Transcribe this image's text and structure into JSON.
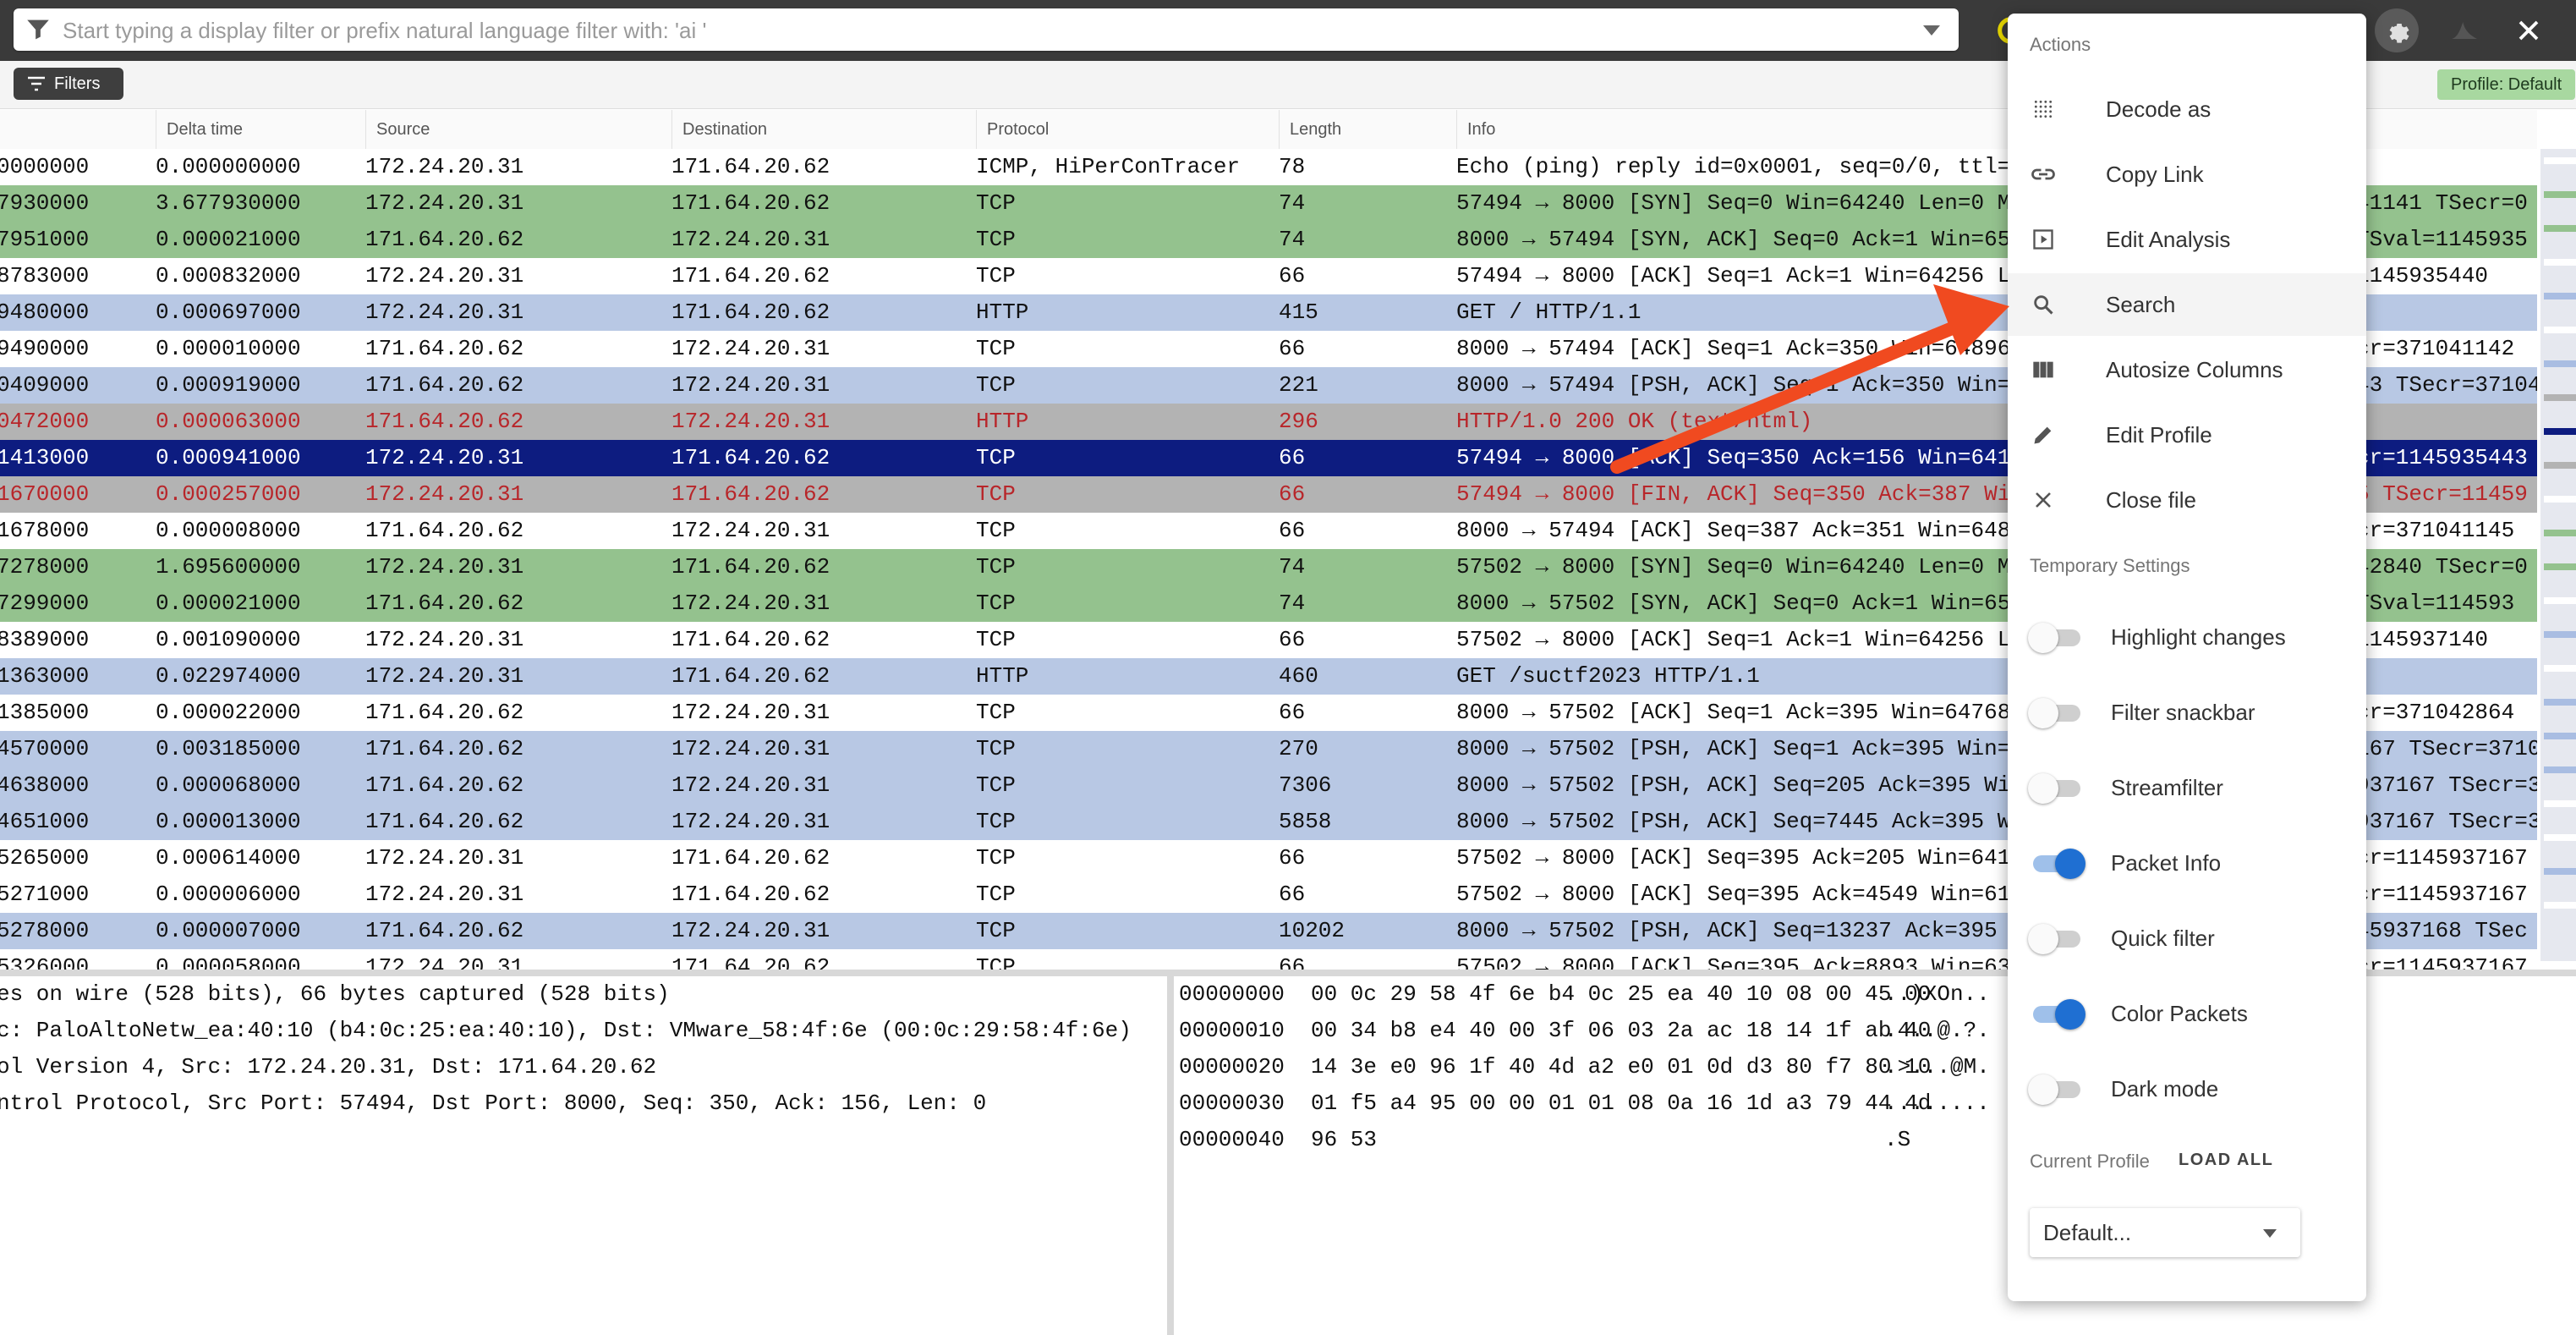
{
  "filter": {
    "placeholder": "Start typing a display filter or prefix natural language filter with: 'ai '"
  },
  "subbar": {
    "filters_label": "Filters",
    "profile_chip": "Profile: Default"
  },
  "columns": [
    "Delta time",
    "Source",
    "Destination",
    "Protocol",
    "Length",
    "Info"
  ],
  "rows": [
    {
      "style": "white",
      "no": "0000000",
      "delta": "0.000000000",
      "src": "172.24.20.31",
      "dst": "171.64.20.62",
      "proto": "ICMP, HiPerConTracer",
      "len": "78",
      "info": "Echo (ping) reply id=0x0001, seq=0/0, ttl=6"
    },
    {
      "style": "green",
      "no": "7930000",
      "delta": "3.677930000",
      "src": "172.24.20.31",
      "dst": "171.64.20.62",
      "proto": "TCP",
      "len": "74",
      "info": "57494 → 8000 [SYN] Seq=0 Win=64240 Len=0 MSS",
      "info2": "41141 TSecr=0"
    },
    {
      "style": "green",
      "no": "7951000",
      "delta": "0.000021000",
      "src": "171.64.20.62",
      "dst": "172.24.20.31",
      "proto": "TCP",
      "len": "74",
      "info": "8000 → 57494 [SYN, ACK] Seq=0 Ack=1 Win=651",
      "info2": "TSval=1145935"
    },
    {
      "style": "white",
      "no": "8783000",
      "delta": "0.000832000",
      "src": "172.24.20.31",
      "dst": "171.64.20.62",
      "proto": "TCP",
      "len": "66",
      "info": "57494 → 8000 [ACK] Seq=1 Ack=1 Win=64256 Le",
      "info2": "1145935440"
    },
    {
      "style": "blue",
      "no": "9480000",
      "delta": "0.000697000",
      "src": "172.24.20.31",
      "dst": "171.64.20.62",
      "proto": "HTTP",
      "len": "415",
      "info": "GET / HTTP/1.1",
      "info2": ""
    },
    {
      "style": "white",
      "no": "9490000",
      "delta": "0.000010000",
      "src": "171.64.20.62",
      "dst": "172.24.20.31",
      "proto": "TCP",
      "len": "66",
      "info": "8000 → 57494 [ACK] Seq=1 Ack=350 Win=64896",
      "info2": "cr=371041142"
    },
    {
      "style": "blue",
      "no": "0409000",
      "delta": "0.000919000",
      "src": "171.64.20.62",
      "dst": "172.24.20.31",
      "proto": "TCP",
      "len": "221",
      "info": "8000 → 57494 [PSH, ACK] Seq=1 Ack=350 Win=6",
      "info2": "43 TSecr=37104"
    },
    {
      "style": "red",
      "no": "0472000",
      "delta": "0.000063000",
      "src": "171.64.20.62",
      "dst": "172.24.20.31",
      "proto": "HTTP",
      "len": "296",
      "info": "HTTP/1.0 200 OK (text/html)",
      "info2": ""
    },
    {
      "style": "sel",
      "no": "1413000",
      "delta": "0.000941000",
      "src": "172.24.20.31",
      "dst": "171.64.20.62",
      "proto": "TCP",
      "len": "66",
      "info": "57494 → 8000 [ACK] Seq=350 Ack=156 Win=6412",
      "info2": "cr=1145935443"
    },
    {
      "style": "red",
      "no": "1670000",
      "delta": "0.000257000",
      "src": "172.24.20.31",
      "dst": "171.64.20.62",
      "proto": "TCP",
      "len": "66",
      "info": "57494 → 8000 [FIN, ACK] Seq=350 Ack=387 Win",
      "info2": "5 TSecr=11459"
    },
    {
      "style": "white",
      "no": "1678000",
      "delta": "0.000008000",
      "src": "171.64.20.62",
      "dst": "172.24.20.31",
      "proto": "TCP",
      "len": "66",
      "info": "8000 → 57494 [ACK] Seq=387 Ack=351 Win=6489",
      "info2": "cr=371041145"
    },
    {
      "style": "green",
      "no": "7278000",
      "delta": "1.695600000",
      "src": "172.24.20.31",
      "dst": "171.64.20.62",
      "proto": "TCP",
      "len": "74",
      "info": "57502 → 8000 [SYN] Seq=0 Win=64240 Len=0 MS",
      "info2": "42840 TSecr=0"
    },
    {
      "style": "green",
      "no": "7299000",
      "delta": "0.000021000",
      "src": "171.64.20.62",
      "dst": "172.24.20.31",
      "proto": "TCP",
      "len": "74",
      "info": "8000 → 57502 [SYN, ACK] Seq=0 Ack=1 Win=651",
      "info2": "TSval=114593"
    },
    {
      "style": "white",
      "no": "8389000",
      "delta": "0.001090000",
      "src": "172.24.20.31",
      "dst": "171.64.20.62",
      "proto": "TCP",
      "len": "66",
      "info": "57502 → 8000 [ACK] Seq=1 Ack=1 Win=64256 Le",
      "info2": "1145937140"
    },
    {
      "style": "blue",
      "no": "1363000",
      "delta": "0.022974000",
      "src": "172.24.20.31",
      "dst": "171.64.20.62",
      "proto": "HTTP",
      "len": "460",
      "info": "GET /suctf2023 HTTP/1.1",
      "info2": ""
    },
    {
      "style": "white",
      "no": "1385000",
      "delta": "0.000022000",
      "src": "171.64.20.62",
      "dst": "172.24.20.31",
      "proto": "TCP",
      "len": "66",
      "info": "8000 → 57502 [ACK] Seq=1 Ack=395 Win=64768",
      "info2": "cr=371042864"
    },
    {
      "style": "blue",
      "no": "4570000",
      "delta": "0.003185000",
      "src": "171.64.20.62",
      "dst": "172.24.20.31",
      "proto": "TCP",
      "len": "270",
      "info": "8000 → 57502 [PSH, ACK] Seq=1 Ack=395 Win=6",
      "info2": "167 TSecr=37104"
    },
    {
      "style": "blue",
      "no": "4638000",
      "delta": "0.000068000",
      "src": "171.64.20.62",
      "dst": "172.24.20.31",
      "proto": "TCP",
      "len": "7306",
      "info": "8000 → 57502 [PSH, ACK] Seq=205 Ack=395 Win",
      "info2": "937167 TSecr=37"
    },
    {
      "style": "blue",
      "no": "4651000",
      "delta": "0.000013000",
      "src": "171.64.20.62",
      "dst": "172.24.20.31",
      "proto": "TCP",
      "len": "5858",
      "info": "8000 → 57502 [PSH, ACK] Seq=7445 Ack=395 W",
      "info2": "937167 TSecr=3"
    },
    {
      "style": "white",
      "no": "5265000",
      "delta": "0.000614000",
      "src": "172.24.20.31",
      "dst": "171.64.20.62",
      "proto": "TCP",
      "len": "66",
      "info": "57502 → 8000 [ACK] Seq=395 Ack=205 Win=6412",
      "info2": "cr=1145937167"
    },
    {
      "style": "white",
      "no": "5271000",
      "delta": "0.000006000",
      "src": "172.24.20.31",
      "dst": "171.64.20.62",
      "proto": "TCP",
      "len": "66",
      "info": "57502 → 8000 [ACK] Seq=395 Ack=4549 Win=613",
      "info2": "cr=1145937167"
    },
    {
      "style": "blue",
      "no": "5278000",
      "delta": "0.000007000",
      "src": "171.64.20.62",
      "dst": "172.24.20.31",
      "proto": "TCP",
      "len": "10202",
      "info": "8000 → 57502 [PSH, ACK] Seq=13237 Ack=395 W",
      "info2": "45937168 TSec"
    },
    {
      "style": "white",
      "no": "5326000",
      "delta": "0.000058000",
      "src": "172.24.20.31",
      "dst": "171.64.20.62",
      "proto": "TCP",
      "len": "66",
      "info": "57502 → 8000 [ACK] Seq=395 Ack=8893 Win=63",
      "info2": "cr=1145937167"
    }
  ],
  "details": [
    "es on wire (528 bits), 66 bytes captured (528 bits)",
    "c: PaloAltoNetw_ea:40:10 (b4:0c:25:ea:40:10), Dst: VMware_58:4f:6e (00:0c:29:58:4f:6e)",
    "ol Version 4, Src: 172.24.20.31, Dst: 171.64.20.62",
    "ntrol Protocol, Src Port: 57494, Dst Port: 8000, Seq: 350, Ack: 156, Len: 0"
  ],
  "hex": [
    {
      "offset": "00000000",
      "bytes": "00 0c 29 58 4f 6e b4 0c  25 ea 40 10 08 00 45 00",
      "ascii": "..)XOn.."
    },
    {
      "offset": "00000010",
      "bytes": "00 34 b8 e4 40 00 3f 06  03 2a ac 18 14 1f ab 40",
      "ascii": ".4..@.?."
    },
    {
      "offset": "00000020",
      "bytes": "14 3e e0 96 1f 40 4d a2  e0 01 0d d3 80 f7 80 10",
      "ascii": ".>...@M."
    },
    {
      "offset": "00000030",
      "bytes": "01 f5 a4 95 00 00 01 01  08 0a 16 1d a3 79 44 4d",
      "ascii": "........"
    },
    {
      "offset": "00000040",
      "bytes": "96 53",
      "ascii": ".S"
    }
  ],
  "menu": {
    "actions_title": "Actions",
    "actions": [
      {
        "icon": "grid-dots-icon",
        "label": "Decode as"
      },
      {
        "icon": "link-icon",
        "label": "Copy Link"
      },
      {
        "icon": "play-box-icon",
        "label": "Edit Analysis"
      },
      {
        "icon": "search-icon",
        "label": "Search"
      },
      {
        "icon": "columns-icon",
        "label": "Autosize Columns"
      },
      {
        "icon": "pencil-icon",
        "label": "Edit Profile"
      },
      {
        "icon": "close-icon",
        "label": "Close file"
      }
    ],
    "temp_title": "Temporary Settings",
    "toggles": [
      {
        "label": "Highlight changes",
        "on": false
      },
      {
        "label": "Filter snackbar",
        "on": false
      },
      {
        "label": "Streamfilter",
        "on": false
      },
      {
        "label": "Packet Info",
        "on": true
      },
      {
        "label": "Quick filter",
        "on": false
      },
      {
        "label": "Color Packets",
        "on": true
      },
      {
        "label": "Dark mode",
        "on": false
      }
    ],
    "current_profile_label": "Current Profile",
    "load_all_label": "LOAD ALL",
    "profile_value": "Default..."
  },
  "colors": {
    "green_row": "#94c28e",
    "blue_row": "#b8c8e4",
    "red_row_text": "#b8262a",
    "selected_row": "#0d1c80",
    "toggle_on": "#1f6fd2",
    "annotation_arrow": "#f04a20"
  }
}
